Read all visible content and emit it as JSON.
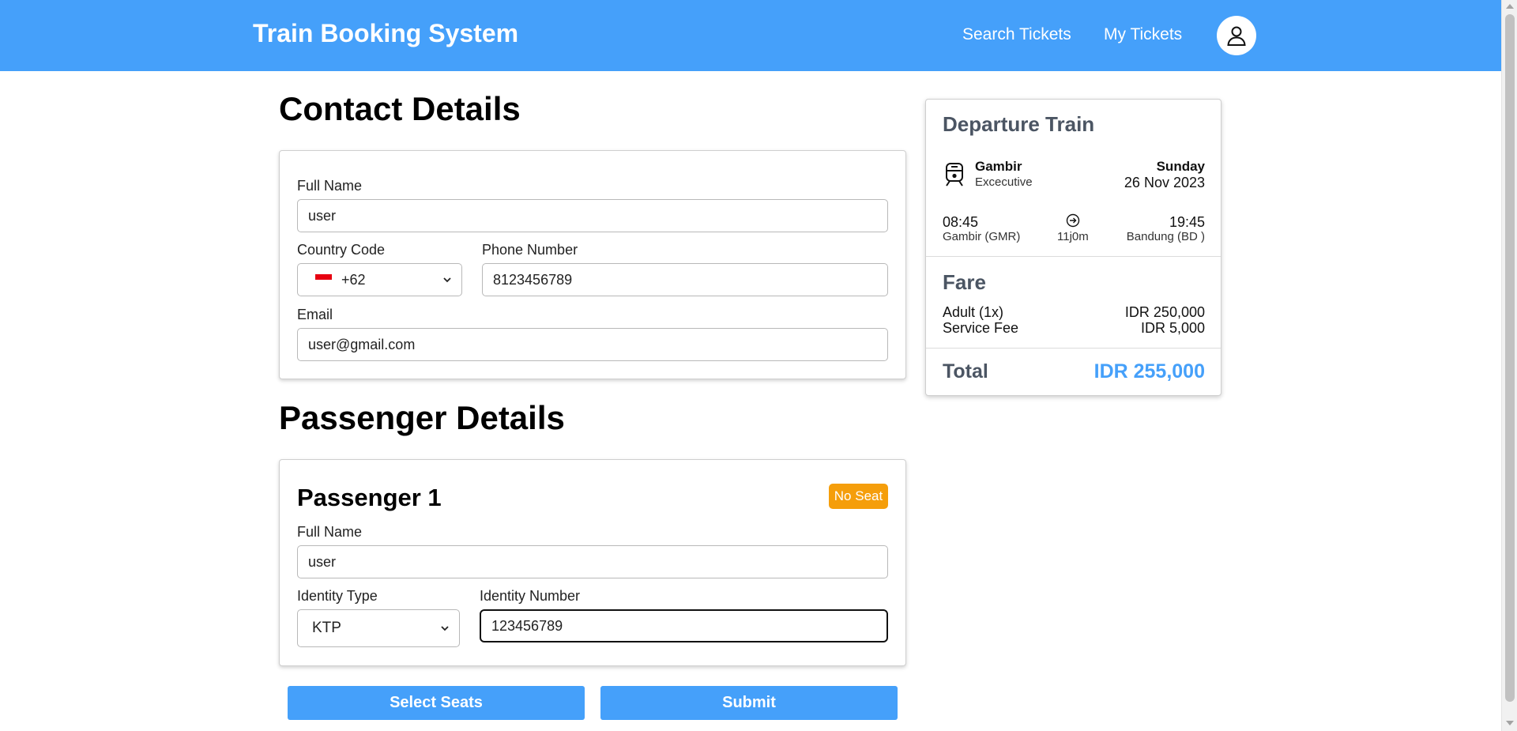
{
  "header": {
    "brand": "Train Booking System",
    "nav": [
      "Search Tickets",
      "My Tickets"
    ],
    "colors": {
      "accent": "#45a0fa",
      "badge_warning": "#f59e0b"
    },
    "icons": {
      "profile": "user-icon"
    }
  },
  "contact": {
    "title": "Contact Details",
    "full_name_label": "Full Name",
    "full_name_value": "user",
    "country_code_label": "Country Code",
    "country_code_value": "+62",
    "phone_label": "Phone Number",
    "phone_value": "8123456789",
    "email_label": "Email",
    "email_value": "user@gmail.com"
  },
  "passenger": {
    "title": "Passenger Details",
    "heading": "Passenger 1",
    "badge": "No Seat",
    "full_name_label": "Full Name",
    "full_name_value": "user",
    "identity_type_label": "Identity Type",
    "identity_type_value": "KTP",
    "identity_number_label": "Identity Number",
    "identity_number_value": "123456789"
  },
  "actions": {
    "select_seats": "Select Seats",
    "submit": "Submit"
  },
  "summary": {
    "title": "Departure Train",
    "station": "Gambir",
    "train_class": "Excecutive",
    "day": "Sunday",
    "date": "26 Nov 2023",
    "depart_time": "08:45",
    "depart_station": "Gambir (GMR)",
    "duration": "11j0m",
    "arrive_time": "19:45",
    "arrive_station": "Bandung (BD )",
    "fare_title": "Fare",
    "fare_items": [
      {
        "label": "Adult (1x)",
        "value": "IDR 250,000"
      },
      {
        "label": "Service Fee",
        "value": "IDR 5,000"
      }
    ],
    "total_label": "Total",
    "total_value": "IDR 255,000"
  }
}
